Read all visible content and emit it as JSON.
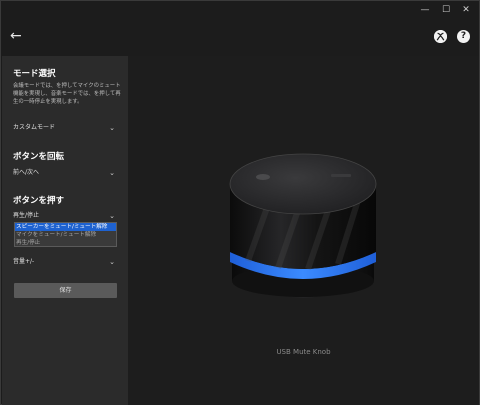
{
  "window_controls": {
    "minimize": "—",
    "maximize": "☐",
    "close": "✕"
  },
  "header": {
    "back_glyph": "←",
    "xbox_icon": "xbox-icon",
    "help_icon": "help-icon",
    "help_glyph": "?"
  },
  "sidebar": {
    "mode": {
      "title": "モード選択",
      "description": "会議モードでは、を押してマイクのミュート機能を実現し、音楽モードでは、を押して再生の一時停止を実現します。",
      "selected": "カスタムモード"
    },
    "rotate": {
      "title": "ボタンを回転",
      "selected": "前へ/次へ"
    },
    "press": {
      "title": "ボタンを押す",
      "selected": "再生/停止",
      "options": [
        "スピーカーをミュート/ミュート解除",
        "マイクをミュート/ミュート解除",
        "再生/停止"
      ],
      "highlighted_index": 0
    },
    "extra": {
      "selected": "音量+/-"
    },
    "save_label": "保存"
  },
  "main": {
    "caption": "USB Mute Knob",
    "colors": {
      "ring": "#2f7dff",
      "body": "#151515",
      "top": "#2a2a2c"
    }
  }
}
